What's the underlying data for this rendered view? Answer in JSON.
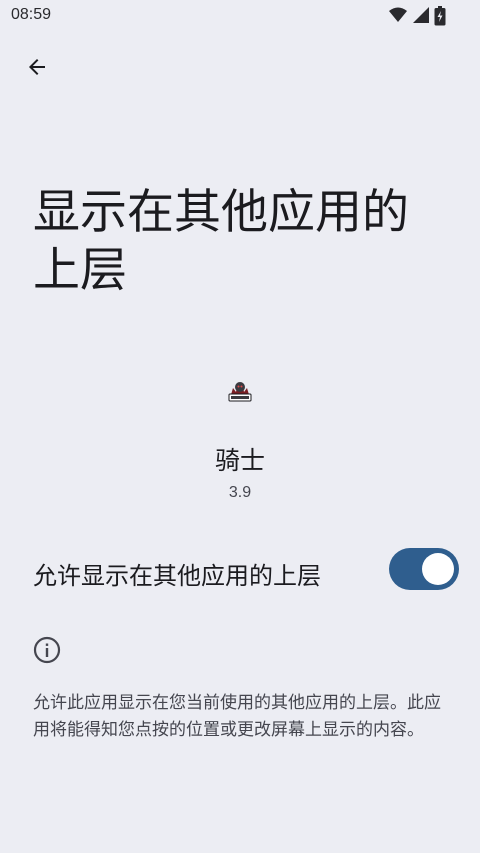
{
  "status_bar": {
    "time": "08:59",
    "icons": [
      "wifi-icon",
      "signal-icon",
      "battery-icon"
    ]
  },
  "toolbar": {
    "back_icon": "back-arrow-icon"
  },
  "page": {
    "title": "显示在其他应用的上层"
  },
  "app": {
    "icon": "app-logo",
    "name": "骑士",
    "version": "3.9"
  },
  "permission": {
    "label": "允许显示在其他应用的上层",
    "enabled": true
  },
  "info": {
    "icon": "info-icon",
    "description": "允许此应用显示在您当前使用的其他应用的上层。此应用将能得知您点按的位置或更改屏幕上显示的内容。"
  },
  "colors": {
    "background": "#ECEDF3",
    "switch_track": "#2F5E8E",
    "switch_thumb": "#FFFFFF",
    "primary_text": "#1B1B1F",
    "secondary_text": "#45464F"
  }
}
